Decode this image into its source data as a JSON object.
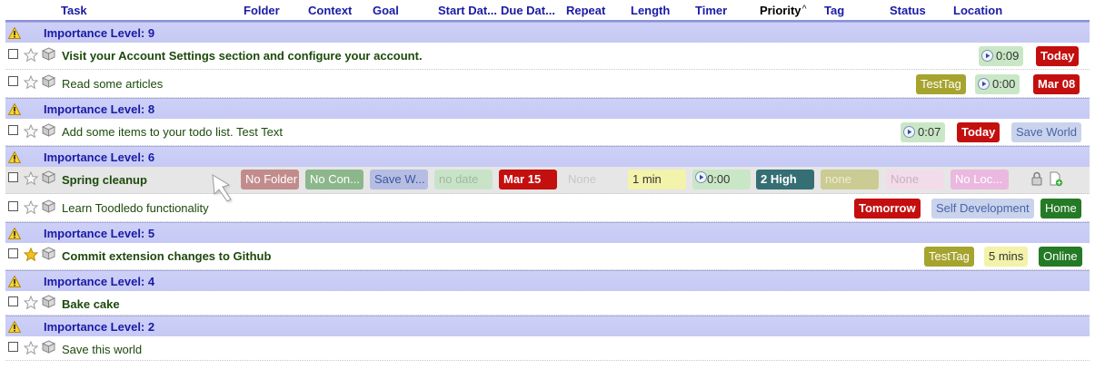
{
  "header": {
    "task": "Task",
    "folder": "Folder",
    "context": "Context",
    "goal": "Goal",
    "start_date": "Start Dat...",
    "due_date": "Due Dat...",
    "repeat": "Repeat",
    "length": "Length",
    "timer": "Timer",
    "priority": "Priority",
    "tag": "Tag",
    "status": "Status",
    "location": "Location"
  },
  "groups": [
    {
      "label": "Importance Level: 9"
    },
    {
      "label": "Importance Level: 8"
    },
    {
      "label": "Importance Level: 6"
    },
    {
      "label": "Importance Level: 5"
    },
    {
      "label": "Importance Level: 4"
    },
    {
      "label": "Importance Level: 2"
    }
  ],
  "tasks": [
    {
      "title": "Visit your Account Settings section and configure your account.",
      "starred": false,
      "bold": true,
      "timer": "0:09",
      "due": "Today"
    },
    {
      "title": "Read some articles",
      "starred": false,
      "bold": false,
      "tag": "TestTag",
      "timer": "0:00",
      "due": "Mar 08"
    },
    {
      "title": "Add some items to your todo list. Test Text",
      "starred": false,
      "bold": false,
      "timer": "0:07",
      "due": "Today",
      "goal": "Save World"
    },
    {
      "title": "Spring cleanup",
      "starred": false,
      "bold": true,
      "folder": "No Folder",
      "context": "No Con...",
      "goal": "Save W...",
      "start": "no date",
      "due": "Mar 15",
      "repeat": "None",
      "length": "1 min",
      "timer": "0:00",
      "priority": "2 High",
      "tag": "none",
      "status": "None",
      "location": "No Loc..."
    },
    {
      "title": "Learn Toodledo functionality",
      "starred": false,
      "bold": false,
      "due": "Tomorrow",
      "goal": "Self Development",
      "location": "Home"
    },
    {
      "title": "Commit extension changes to Github",
      "starred": true,
      "bold": true,
      "tag": "TestTag",
      "length": "5 mins",
      "location": "Online"
    },
    {
      "title": "Bake cake",
      "starred": false,
      "bold": true
    },
    {
      "title": "Save this world",
      "starred": false,
      "bold": false
    }
  ],
  "colors": {
    "header_text": "#1a1aa6",
    "group_bg": "#cdd0f7",
    "due_red": "#c40f0f",
    "tag_olive": "#a6a42e",
    "timer_green": "#c9e7c6",
    "location_green": "#257a25",
    "priority_teal": "#356f74",
    "star_gold": "#f2c21a"
  },
  "icons": [
    "warning-icon",
    "star-icon",
    "cube-icon",
    "play-icon",
    "cursor-pointer-icon",
    "lock-icon",
    "add-subtask-icon"
  ]
}
